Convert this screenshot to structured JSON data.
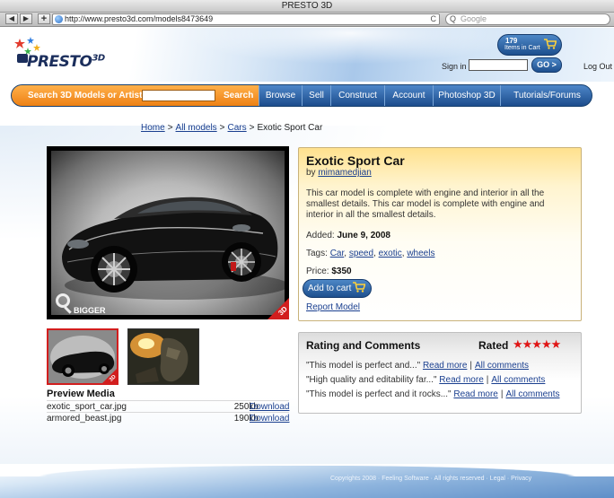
{
  "window": {
    "title": "PRESTO 3D"
  },
  "browser": {
    "back_glyph": "◀",
    "forward_glyph": "▶",
    "add_glyph": "+",
    "url": "http://www.presto3d.com/models8473649",
    "reload_glyph": "C",
    "search_placeholder": "Google",
    "search_glyph": "Q"
  },
  "header": {
    "logo_text": "PRESTO",
    "logo_sup": "3D",
    "cart_count": "179",
    "cart_label": "Items in Cart",
    "signin_label": "Sign in",
    "go_label": "GO >",
    "logout_label": "Log Out"
  },
  "nav": {
    "search_label": "Search 3D Models or Artists",
    "search_button": "Search",
    "items": [
      "Browse",
      "Sell",
      "Construct",
      "Account",
      "Photoshop 3D",
      "Tutorials/Forums"
    ]
  },
  "breadcrumb": {
    "items": [
      "Home",
      "All models",
      "Cars"
    ],
    "current": "Exotic Sport Car",
    "separator": ">"
  },
  "gallery": {
    "bigger_label": "BIGGER",
    "badge_label": "3D",
    "preview_title": "Preview Media",
    "media": [
      {
        "name": "exotic_sport_car.jpg",
        "size": "250kb",
        "action": "Download"
      },
      {
        "name": "armored_beast.jpg",
        "size": "190kb",
        "action": "Download"
      }
    ]
  },
  "model": {
    "title": "Exotic Sport Car",
    "by_prefix": "by",
    "author": "mimamedjian",
    "description": "This car model is complete with engine and interior in all the smallest details. This car model is complete with engine and interior in all the smallest details.",
    "added_label": "Added:",
    "added_date": "June 9, 2008",
    "tags_label": "Tags:",
    "tags": [
      "Car",
      "speed",
      "exotic",
      "wheels"
    ],
    "price_label": "Price:",
    "price": "$350",
    "add_to_cart": "Add to cart",
    "report": "Report Model"
  },
  "rating": {
    "title": "Rating and Comments",
    "rated_label": "Rated",
    "stars_glyphs": "★★★★★",
    "star_value": 5,
    "comments": [
      {
        "text": "\"This model is perfect and...\"",
        "read_more": "Read more",
        "all": "All comments"
      },
      {
        "text": "\"High quality and editability far...\"",
        "read_more": "Read more",
        "all": "All comments"
      },
      {
        "text": "\"This model is perfect and it rocks...\"",
        "read_more": "Read more",
        "all": "All comments"
      }
    ]
  },
  "footer": {
    "text": "Copyrights 2008 · Feeling Software · All rights reserved · Legal · Privacy"
  },
  "colors": {
    "accent_blue": "#1d4f8e",
    "search_orange": "#ec7d10",
    "star_red": "#e01515",
    "info_panel_yellow": "#ffe18e",
    "thumb_selected_border": "#d21e1e"
  }
}
